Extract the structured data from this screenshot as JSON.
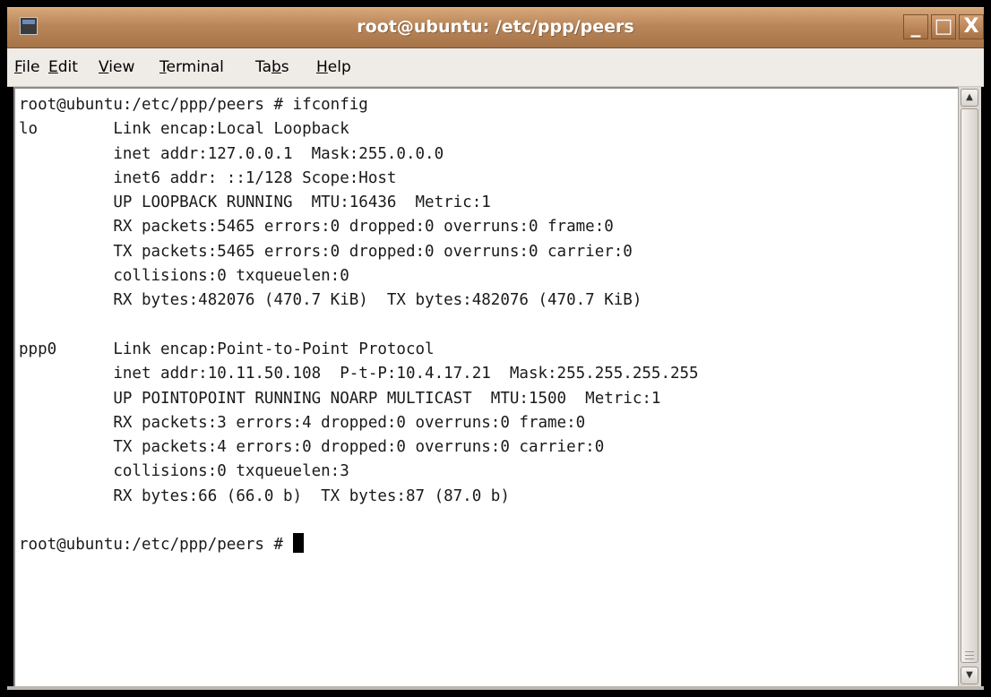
{
  "window": {
    "title": "root@ubuntu: /etc/ppp/peers",
    "buttons": {
      "minimize": "_",
      "maximize": "□",
      "close": "X"
    }
  },
  "menubar": {
    "items": [
      {
        "mnemonic": "F",
        "rest": "ile"
      },
      {
        "mnemonic": "E",
        "rest": "dit"
      },
      {
        "mnemonic": "V",
        "rest": "iew"
      },
      {
        "mnemonic": "T",
        "rest": "erminal"
      },
      {
        "before": "Ta",
        "mnemonic": "b",
        "rest": "s"
      },
      {
        "mnemonic": "H",
        "rest": "elp"
      }
    ]
  },
  "terminal": {
    "lines": [
      "root@ubuntu:/etc/ppp/peers # ifconfig",
      "lo        Link encap:Local Loopback",
      "          inet addr:127.0.0.1  Mask:255.0.0.0",
      "          inet6 addr: ::1/128 Scope:Host",
      "          UP LOOPBACK RUNNING  MTU:16436  Metric:1",
      "          RX packets:5465 errors:0 dropped:0 overruns:0 frame:0",
      "          TX packets:5465 errors:0 dropped:0 overruns:0 carrier:0",
      "          collisions:0 txqueuelen:0",
      "          RX bytes:482076 (470.7 KiB)  TX bytes:482076 (470.7 KiB)",
      "",
      "ppp0      Link encap:Point-to-Point Protocol",
      "          inet addr:10.11.50.108  P-t-P:10.4.17.21  Mask:255.255.255.255",
      "          UP POINTOPOINT RUNNING NOARP MULTICAST  MTU:1500  Metric:1",
      "          RX packets:3 errors:4 dropped:0 overruns:0 frame:0",
      "          TX packets:4 errors:0 dropped:0 overruns:0 carrier:0",
      "          collisions:0 txqueuelen:3",
      "          RX bytes:66 (66.0 b)  TX bytes:87 (87.0 b)",
      ""
    ],
    "prompt": "root@ubuntu:/etc/ppp/peers # "
  },
  "icons": {
    "app": "terminal-icon",
    "scroll_up": "arrow-up-icon",
    "scroll_down": "arrow-down-icon"
  }
}
